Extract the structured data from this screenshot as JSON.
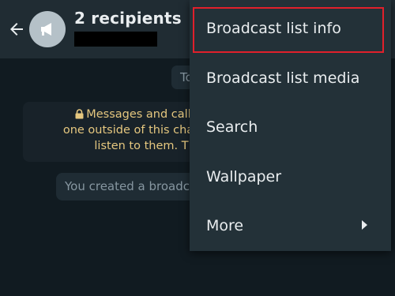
{
  "header": {
    "title": "2 recipients"
  },
  "chat": {
    "date_chip": "To",
    "encryption_notice": [
      "Messages and calls a",
      "one outside of this chat, no",
      "listen to them. T"
    ],
    "system_message": "You created a broadc"
  },
  "menu": {
    "items": [
      {
        "label": "Broadcast list info",
        "highlighted": true
      },
      {
        "label": "Broadcast list media"
      },
      {
        "label": "Search"
      },
      {
        "label": "Wallpaper"
      },
      {
        "label": "More",
        "has_submenu": true
      }
    ]
  },
  "colors": {
    "header_bg": "#202c33",
    "chat_bg": "#111b21",
    "menu_bg": "#233138",
    "highlight": "#e0202b",
    "notice_text": "#e5c77f"
  },
  "icons": {
    "back": "arrow-left-icon",
    "avatar": "megaphone-icon",
    "lock": "lock-icon",
    "submenu": "caret-right-icon"
  }
}
